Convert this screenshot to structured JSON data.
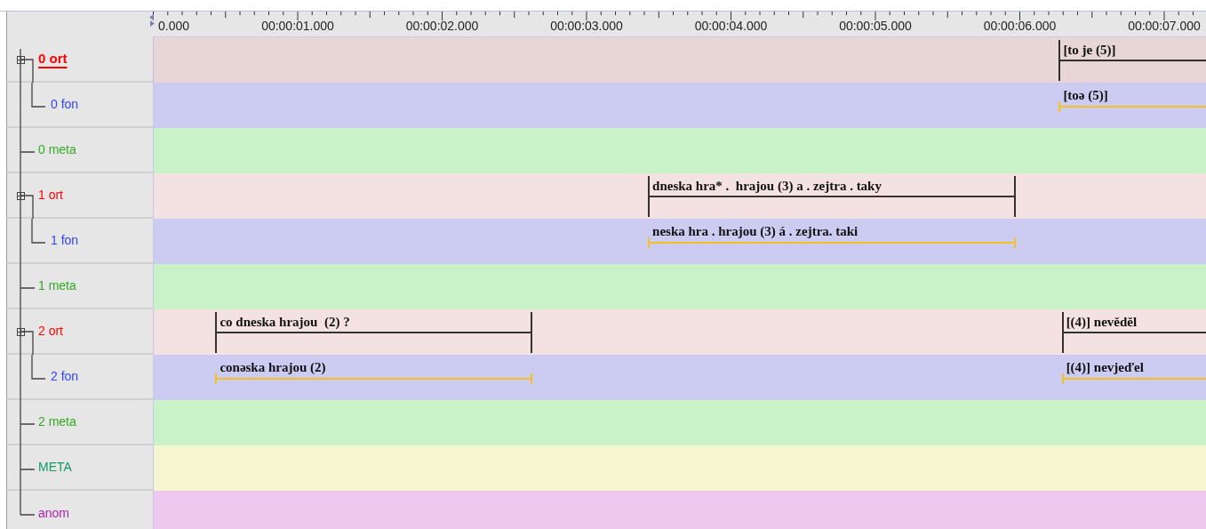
{
  "ruler": {
    "labels": [
      "0.000",
      "00:00:01.000",
      "00:00:02.000",
      "00:00:03.000",
      "00:00:04.000",
      "00:00:05.000",
      "00:00:06.000",
      "00:00:07.000"
    ]
  },
  "tiers": [
    {
      "label": "0 ort",
      "kind": "ort",
      "selected": true,
      "expanded": true,
      "annotations": [
        {
          "text": "[to je (5)]"
        }
      ],
      "children": [
        {
          "label": "0 fon",
          "kind": "fon",
          "selected": false,
          "annotations": [
            {
              "text": "[toə (5)]"
            }
          ]
        }
      ]
    },
    {
      "label": "0 meta",
      "kind": "meta",
      "selected": false
    },
    {
      "label": "1 ort",
      "kind": "ort",
      "selected": false,
      "expanded": true,
      "annotations": [
        {
          "text": "dneska hra* .  hrajou (3) a . zejtra . taky"
        }
      ],
      "children": [
        {
          "label": "1 fon",
          "kind": "fon",
          "selected": false,
          "annotations": [
            {
              "text": "neska hra . hrajou (3) á . zejtra. taki"
            }
          ]
        }
      ]
    },
    {
      "label": "1 meta",
      "kind": "meta",
      "selected": false
    },
    {
      "label": "2 ort",
      "kind": "ort",
      "selected": false,
      "expanded": true,
      "annotations": [
        {
          "text": "co dneska hrajou  (2) ?"
        },
        {
          "text": "[(4)] nevěděl"
        }
      ],
      "children": [
        {
          "label": "2 fon",
          "kind": "fon",
          "selected": false,
          "annotations": [
            {
              "text": "conəska hrajou (2)"
            },
            {
              "text": "[(4)] nevjeďel"
            }
          ]
        }
      ]
    },
    {
      "label": "2 meta",
      "kind": "meta",
      "selected": false
    },
    {
      "label": "META",
      "kind": "global",
      "selected": false
    },
    {
      "label": "anom",
      "kind": "anom",
      "selected": false
    }
  ]
}
